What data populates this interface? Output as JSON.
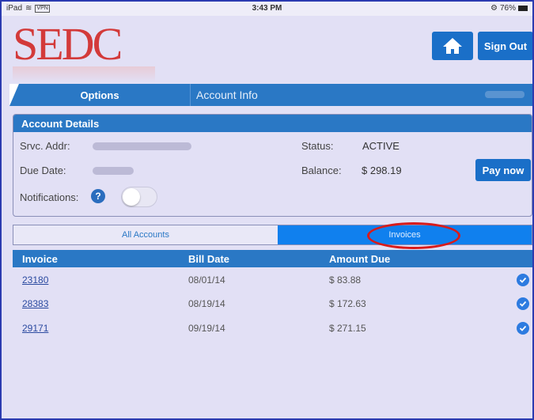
{
  "status_bar": {
    "device": "iPad",
    "vpn": "VPN",
    "time": "3:43 PM",
    "battery": "76%"
  },
  "header": {
    "logo": "SEDC",
    "sign_out_label": "Sign Out",
    "home_icon": "home-icon"
  },
  "nav": {
    "options_label": "Options",
    "account_info_label": "Account Info"
  },
  "details": {
    "title": "Account Details",
    "srvc_addr_label": "Srvc. Addr:",
    "due_date_label": "Due Date:",
    "notifications_label": "Notifications:",
    "status_label": "Status:",
    "status_value": "ACTIVE",
    "balance_label": "Balance:",
    "balance_value": "$ 298.19",
    "pay_now_label": "Pay now",
    "help_glyph": "?",
    "notifications_enabled": false
  },
  "tabs": {
    "all_accounts_label": "All Accounts",
    "invoices_label": "Invoices",
    "selected": "Invoices"
  },
  "table": {
    "columns": [
      "Invoice",
      "Bill Date",
      "Amount Due"
    ],
    "rows": [
      {
        "invoice": "23180",
        "bill_date": "08/01/14",
        "amount_due": "$ 83.88"
      },
      {
        "invoice": "28383",
        "bill_date": "08/19/14",
        "amount_due": "$ 172.63"
      },
      {
        "invoice": "29171",
        "bill_date": "09/19/14",
        "amount_due": "$ 271.15"
      }
    ]
  },
  "colors": {
    "brand_red": "#d33a3a",
    "accent_blue": "#2a78c5",
    "button_blue": "#1a6fc8",
    "highlight_red": "#d81b1b"
  }
}
